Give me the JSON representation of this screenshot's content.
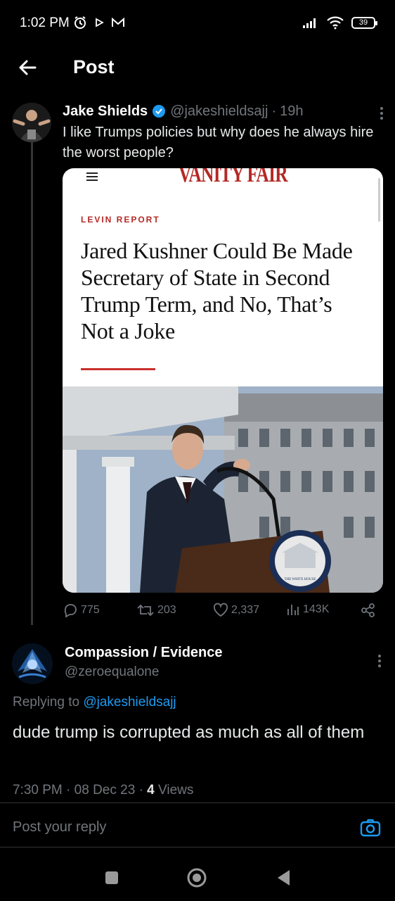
{
  "status_bar": {
    "time": "1:02 PM",
    "battery": "39",
    "left_icons": [
      "alarm-icon",
      "play-icon",
      "gmail-icon"
    ],
    "right_icons": [
      "signal-icon",
      "wifi-icon",
      "battery-icon"
    ]
  },
  "header": {
    "title": "Post",
    "back_icon": "arrow-left-icon"
  },
  "tweet": {
    "name": "Jake Shields",
    "handle": "@jakeshieldsajj",
    "dot": "·",
    "time": "19h",
    "text": "I like Trumps policies but why does he always hire the worst people?",
    "media": {
      "publication": "VANITY FAIR",
      "kicker": "LEVIN REPORT",
      "headline": "Jared Kushner Could Be Made Secretary of State in Second Trump Term, and No, That’s Not a Joke",
      "podium_seal_text": "THE WHITE HOUSE"
    },
    "stats": {
      "replies": "775",
      "reposts": "203",
      "likes": "2,337",
      "views": "143K"
    }
  },
  "reply": {
    "name": "Compassion / Evidence",
    "handle": "@zeroequalone",
    "replying_prefix": "Replying to",
    "replying_to": "@jakeshieldsajj",
    "text": "dude trump is corrupted as much as all of them",
    "time": "7:30 PM",
    "dot": "·",
    "date": "08 Dec 23",
    "views_count": "4",
    "views_label": "Views"
  },
  "composer": {
    "placeholder": "Post your reply"
  },
  "colors": {
    "accent": "#1d9bf0",
    "muted": "#71767b",
    "background": "#000000",
    "brand_red": "#b42824"
  }
}
